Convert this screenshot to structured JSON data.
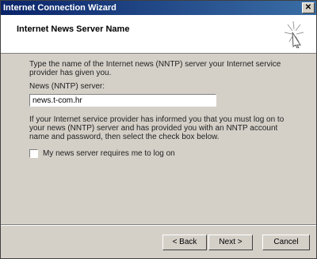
{
  "window": {
    "title": "Internet Connection Wizard",
    "close_glyph": "✕"
  },
  "header": {
    "title": "Internet News Server Name",
    "icon": "wizard-spark-icon"
  },
  "content": {
    "intro": "Type the name of the Internet news (NNTP) server your Internet service provider has given you.",
    "field_label": "News (NNTP) server:",
    "field_value": "news.t-com.hr",
    "info": "If your Internet service provider has informed you that you must log on to your news (NNTP) server and has provided you with an NNTP account name and password, then select the check box below.",
    "checkbox_label": "My news server requires me to log on",
    "checkbox_checked": false
  },
  "buttons": {
    "back": "< Back",
    "next": "Next >",
    "cancel": "Cancel"
  }
}
